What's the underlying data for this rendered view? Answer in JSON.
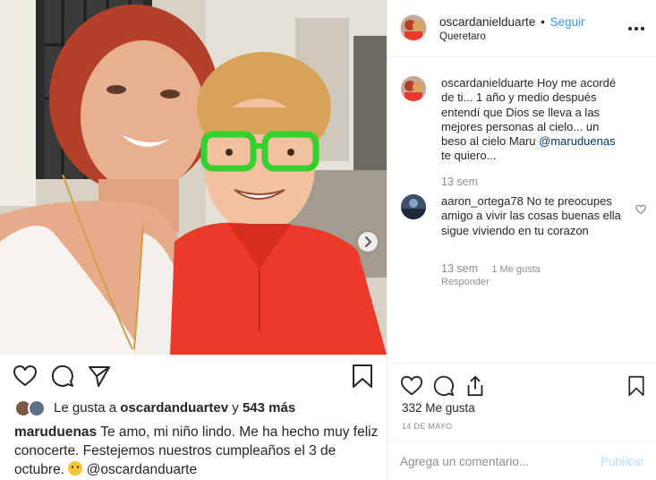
{
  "post": {
    "author": "oscardanielduarte",
    "follow_label": "Seguir",
    "separator": "•",
    "location": "Queretaro",
    "likes_count": "332 Me gusta",
    "date": "14 DE MAYO"
  },
  "left_panel": {
    "liked_by_prefix": "Le gusta a",
    "liked_by_user": "oscardanduartev",
    "liked_by_connector": "y",
    "liked_by_more": "543 más",
    "caption_user": "maruduenas",
    "caption_text": "Te amo, mi niño lindo. Me ha hecho muy feliz conocerte. Festejemos nuestros cumpleaños el 3 de octubre.",
    "caption_mention": "@oscardanduarte"
  },
  "comments": [
    {
      "user": "oscardanielduarte",
      "text": "Hoy me acordé de ti... 1 año y medio después entendí que Dios se lleva a las mejores personas al cielo... un beso al cielo Maru",
      "mention": "@maruduenas",
      "text_after": "te quiero...",
      "time": "13 sem"
    },
    {
      "user": "aaron_ortega78",
      "text": "No te preocupes amigo a vivir las cosas buenas ella sigue viviendo en tu corazon",
      "time": "13 sem",
      "likes": "1 Me gusta",
      "reply_label": "Responder"
    }
  ],
  "add_comment": {
    "placeholder": "Agrega un comentario...",
    "publish_label": "Publicar"
  },
  "icons": {
    "like": "heart-icon",
    "comment": "comment-bubble-icon",
    "share": "paper-plane-icon",
    "share_alt": "share-upload-icon",
    "save": "bookmark-icon",
    "more": "more-options-icon",
    "next": "chevron-right-icon"
  },
  "colors": {
    "link_blue": "#3897f0",
    "publish_disabled": "#b2dffc",
    "mention_dark": "#00376b",
    "secondary_text": "#8e8e8e"
  }
}
